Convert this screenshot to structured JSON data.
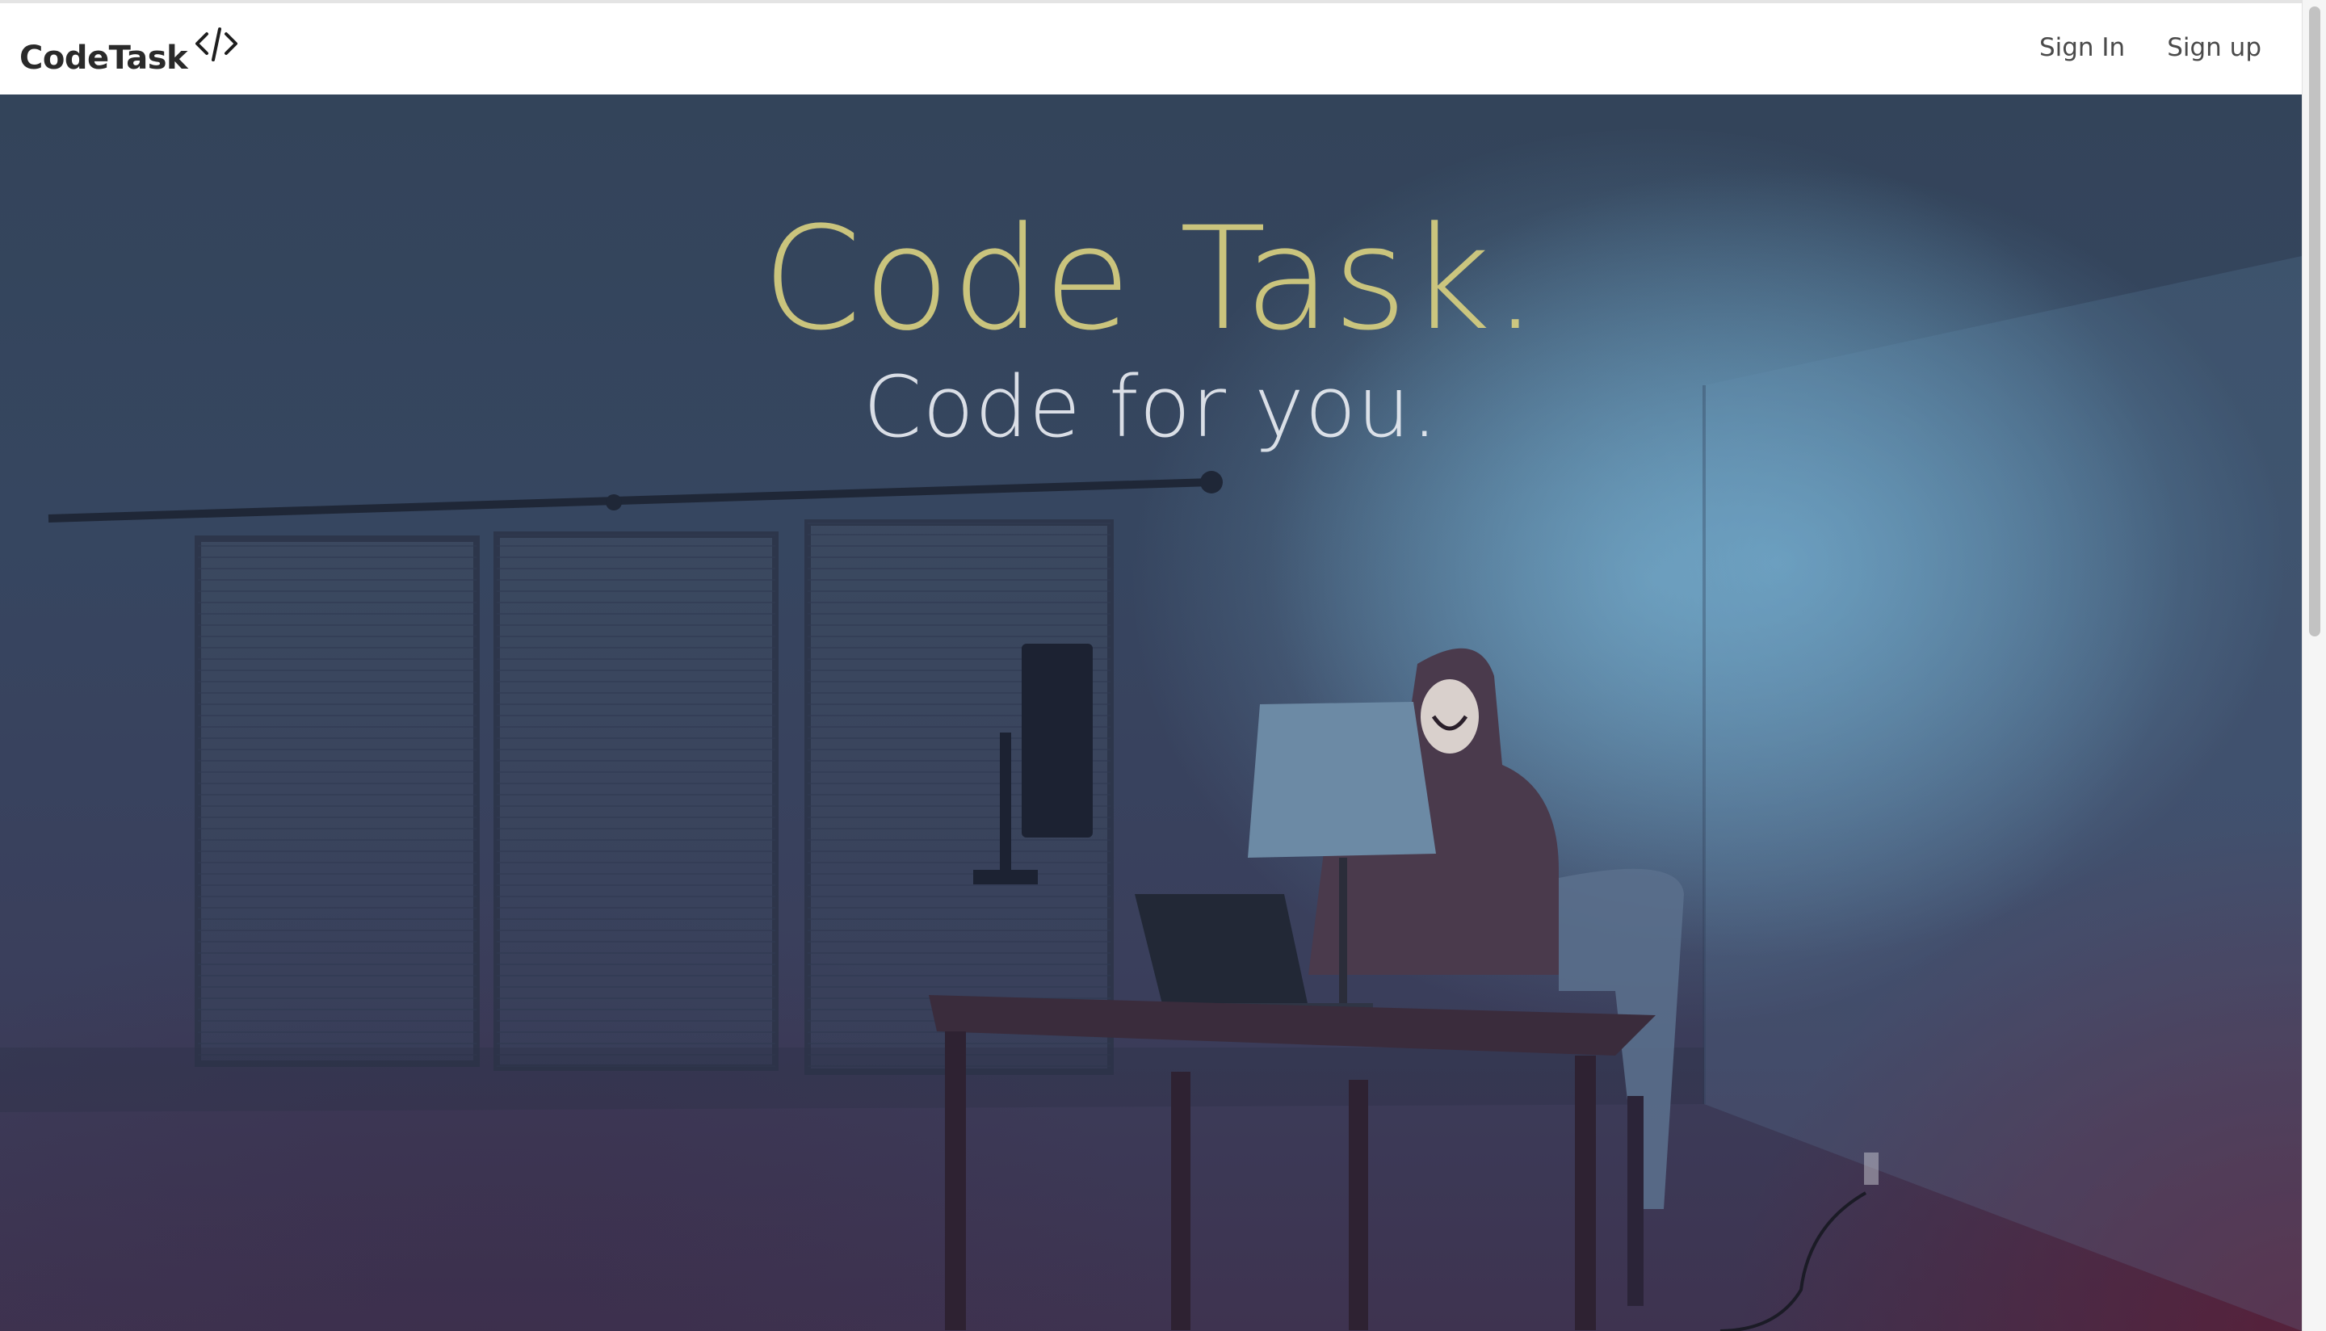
{
  "navbar": {
    "brand_name": "CodeTask",
    "brand_icon": "code-brackets-icon",
    "links": [
      {
        "label": "Sign In"
      },
      {
        "label": "Sign up"
      }
    ]
  },
  "hero": {
    "title": "Code Task.",
    "subtitle": "Code for you.",
    "background_image": "person-in-hoodie-at-desk-with-laptop-and-lamp"
  },
  "colors": {
    "title": "#d7cf80",
    "subtitle": "#e8ecf2",
    "nav_text": "#4a4a4a",
    "brand_text": "#2a2a2a"
  }
}
